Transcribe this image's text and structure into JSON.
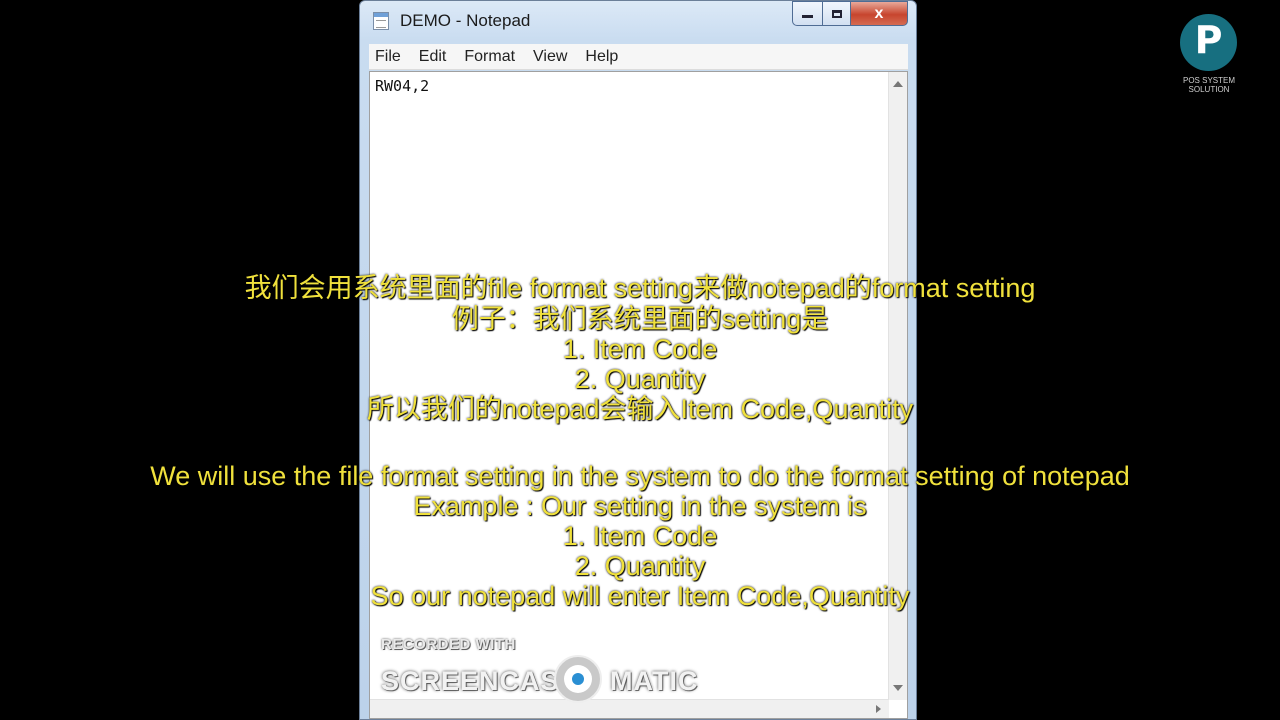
{
  "window": {
    "title": "DEMO - Notepad",
    "close_glyph": "x",
    "menu": [
      "File",
      "Edit",
      "Format",
      "View",
      "Help"
    ],
    "content": "RW04,2"
  },
  "watermark": {
    "recorded_with": "RECORDED WITH",
    "brand_left": "SCREENCAST",
    "brand_right": "MATIC"
  },
  "logo": {
    "glyph": "P",
    "line1": "POS SYSTEM",
    "line2": "SOLUTION"
  },
  "subtitles": {
    "chinese": [
      "我们会用系统里面的file format setting来做notepad的format setting",
      "例子：我们系统里面的setting是",
      "1. Item Code",
      "2. Quantity",
      "所以我们的notepad会输入Item Code,Quantity"
    ],
    "english": [
      "We will use the file format setting in the system to do the format setting of notepad",
      "Example : Our setting in the system is",
      "1. Item Code",
      "2. Quantity",
      "So our notepad will enter Item Code,Quantity"
    ]
  }
}
